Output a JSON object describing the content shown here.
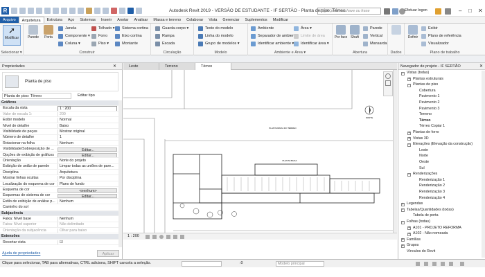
{
  "titlebar": {
    "app_logo": "R",
    "title": "Autodesk Revit 2019 - VERSÃO DE ESTUDANTE - IF SERTÃO - Planta de piso: Térreo",
    "search_placeholder": "Digite palavra-chave ou frase",
    "login": "Efetuar logon",
    "minimize": "–",
    "maximize": "□",
    "close": "✕"
  },
  "tabs": [
    "Arquivo",
    "Arquitetura",
    "Estrutura",
    "Aço",
    "Sistemas",
    "Inserir",
    "Anotar",
    "Analisar",
    "Massa e terreno",
    "Colaborar",
    "Vista",
    "Gerenciar",
    "Suplementos",
    "Modificar"
  ],
  "active_tab": "Arquitetura",
  "ribbon": {
    "modify": "Modificar",
    "select_label": "Selecionar ▾",
    "build_label": "Construir",
    "build_big": [
      "Parede",
      "Porta"
    ],
    "build_small": [
      "Janela",
      "Componente ▾",
      "Coluna ▾",
      "Telhado ▾",
      "Forro",
      "Piso ▾",
      "Sistema cortina",
      "Eixo cortina",
      "Montante"
    ],
    "circ_label": "Circulação",
    "circ_items": [
      "Guarda-corpo ▾",
      "Rampa",
      "Escada"
    ],
    "model_label": "Modelo",
    "model_items": [
      "Texto do modelo",
      "Linha do modelo",
      "Grupo de modelos ▾"
    ],
    "room_label": "Ambiente e Área ▾",
    "room_items": [
      "Ambiente",
      "Separador de ambiente",
      "Identificar ambiente ▾",
      "Área ▾",
      "Limite de área",
      "Identificar área ▾"
    ],
    "opening_label": "Abertura",
    "opening_big": [
      "Por face",
      "Shaft"
    ],
    "opening_small": [
      "Parede",
      "Vertical",
      "Mansarda"
    ],
    "datum_label": "Dados",
    "workplane_label": "Plano de trabalho",
    "workplane_big": "Definir",
    "workplane_small": [
      "Exibir",
      "Plano de referência",
      "Visualizador"
    ]
  },
  "properties": {
    "title": "Propriedades",
    "type_name": "Planta de piso",
    "selector": "Planta de piso: Térreo",
    "edit_type": "Editar tipo",
    "rows": [
      {
        "k": "Gráficos",
        "v": "",
        "kind": "sec"
      },
      {
        "k": "Escala da vista",
        "v": "1 : 200",
        "kind": "in"
      },
      {
        "k": "Valor de escala  1:",
        "v": "200",
        "kind": "dim"
      },
      {
        "k": "Exibir modelo",
        "v": "Normal",
        "kind": ""
      },
      {
        "k": "Nível de detalhe",
        "v": "Baixo",
        "kind": ""
      },
      {
        "k": "Visibilidade de peças",
        "v": "Mostrar original",
        "kind": ""
      },
      {
        "k": "Número de detalhe",
        "v": "1",
        "kind": ""
      },
      {
        "k": "Rotacionar na folha",
        "v": "Nenhum",
        "kind": ""
      },
      {
        "k": "Visibilidade/Sobreposição de ...",
        "v": "Editar...",
        "kind": "btn"
      },
      {
        "k": "Opções de exibição de gráficos",
        "v": "Editar...",
        "kind": "btn"
      },
      {
        "k": "Orientação",
        "v": "Norte do projeto",
        "kind": ""
      },
      {
        "k": "Exibição de união de parede",
        "v": "Limpar todas as uniões de pare...",
        "kind": ""
      },
      {
        "k": "Disciplina",
        "v": "Arquitetura",
        "kind": ""
      },
      {
        "k": "Mostrar linhas ocultas",
        "v": "Por disciplina",
        "kind": ""
      },
      {
        "k": "Localização do esquema de cor",
        "v": "Plano de fundo",
        "kind": ""
      },
      {
        "k": "Esquema de cor",
        "v": "<nenhum>",
        "kind": "btn"
      },
      {
        "k": "Esquemas de sistema de cor",
        "v": "Editar...",
        "kind": "btn"
      },
      {
        "k": "Estilo de exibição de análise p...",
        "v": "Nenhum",
        "kind": ""
      },
      {
        "k": "Caminho do sol",
        "v": "",
        "kind": ""
      },
      {
        "k": "Subjacência",
        "v": "",
        "kind": "sec"
      },
      {
        "k": "Faixa: Nível base",
        "v": "Nenhum",
        "kind": ""
      },
      {
        "k": "Faixa: Nível superior",
        "v": "Não delimitado",
        "kind": "dim"
      },
      {
        "k": "Orientação da subjacência",
        "v": "Olhar para baixo",
        "kind": "dim"
      },
      {
        "k": "Extensões",
        "v": "",
        "kind": "sec"
      },
      {
        "k": "Recortar vista",
        "v": "☑",
        "kind": ""
      }
    ],
    "help_link": "Ajuda de propriedades",
    "apply": "Aplicar"
  },
  "view_tabs": [
    "Leste",
    "Terreno",
    "Térreo"
  ],
  "active_view": "Térreo",
  "view_control": {
    "scale": "1 : 200"
  },
  "browser": {
    "title": "Navegador de projeto - IF SERTÃO",
    "items": [
      {
        "label": "Vistas (todas)",
        "level": 0,
        "toggle": "−"
      },
      {
        "label": "Plantas estruturais",
        "level": 1,
        "toggle": "+"
      },
      {
        "label": "Plantas de piso",
        "level": 1,
        "toggle": "−"
      },
      {
        "label": "Cobertura",
        "level": 2
      },
      {
        "label": "Pavimento 1",
        "level": 2
      },
      {
        "label": "Pavimento 2",
        "level": 2
      },
      {
        "label": "Pavimento 3",
        "level": 2
      },
      {
        "label": "Terreno",
        "level": 2
      },
      {
        "label": "Térreo",
        "level": 2,
        "selected": true
      },
      {
        "label": "Térreo Copiar 1",
        "level": 2
      },
      {
        "label": "Plantas de forro",
        "level": 1,
        "toggle": "+"
      },
      {
        "label": "Vistas 3D",
        "level": 1,
        "toggle": "+"
      },
      {
        "label": "Elevações (Elevação da construção)",
        "level": 1,
        "toggle": "−"
      },
      {
        "label": "Leste",
        "level": 2
      },
      {
        "label": "Norte",
        "level": 2
      },
      {
        "label": "Oeste",
        "level": 2
      },
      {
        "label": "Sul",
        "level": 2
      },
      {
        "label": "Renderizações",
        "level": 1,
        "toggle": "−"
      },
      {
        "label": "Renderização 1",
        "level": 2
      },
      {
        "label": "Renderização 2",
        "level": 2
      },
      {
        "label": "Renderização 3",
        "level": 2
      },
      {
        "label": "Renderização 4",
        "level": 2
      },
      {
        "label": "Legendas",
        "level": 0,
        "toggle": "+"
      },
      {
        "label": "Tabelas/Quantidades (todas)",
        "level": 0,
        "toggle": "−"
      },
      {
        "label": "Tabela de porta",
        "level": 1
      },
      {
        "label": "Folhas (todas)",
        "level": 0,
        "toggle": "−"
      },
      {
        "label": "A101 - PROJETO REFORMA",
        "level": 1,
        "toggle": "+"
      },
      {
        "label": "A102 - Não nomeada",
        "level": 1,
        "toggle": "+"
      },
      {
        "label": "Famílias",
        "level": 0,
        "toggle": "+"
      },
      {
        "label": "Grupos",
        "level": 0,
        "toggle": "+"
      },
      {
        "label": "Vínculos do Revit",
        "level": 0
      }
    ]
  },
  "status": {
    "text": "Clique para selecionar, TAB para alternativas, CTRL adiciona, SHIFT cancela a seleção.",
    "zero": ":0",
    "model": "Modelo principal"
  },
  "canvas": {
    "title_small": "PLANTA BAIXA DO TÉRREO",
    "north_label": "NORTE",
    "room_label": "PLANTA BAIXA"
  }
}
